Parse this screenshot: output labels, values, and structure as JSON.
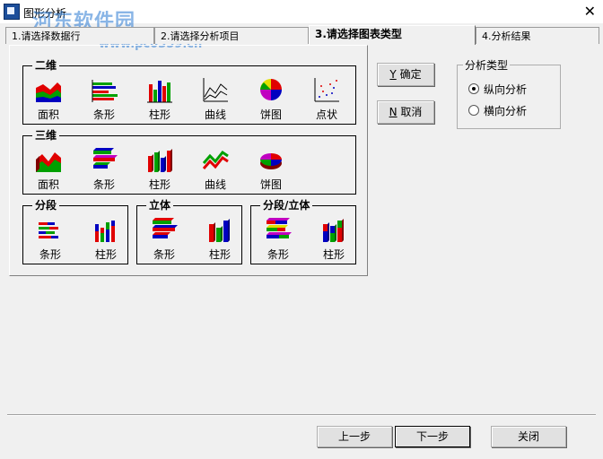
{
  "window": {
    "title": "图形分析",
    "watermark": "河东软件园",
    "watermark_url": "www.pc0359.cn"
  },
  "tabs": [
    {
      "label": "1.请选择数据行"
    },
    {
      "label": "2.请选择分析项目"
    },
    {
      "label": "3.请选择图表类型"
    },
    {
      "label": "4.分析结果"
    }
  ],
  "groups": {
    "two_d": {
      "title": "二维",
      "items": [
        "面积",
        "条形",
        "柱形",
        "曲线",
        "饼图",
        "点状"
      ]
    },
    "three_d": {
      "title": "三维",
      "items": [
        "面积",
        "条形",
        "柱形",
        "曲线",
        "饼图"
      ]
    },
    "segment": {
      "title": "分段",
      "items": [
        "条形",
        "柱形"
      ]
    },
    "solid": {
      "title": "立体",
      "items": [
        "条形",
        "柱形"
      ]
    },
    "segment_solid": {
      "title": "分段/立体",
      "items": [
        "条形",
        "柱形"
      ]
    }
  },
  "buttons": {
    "ok": {
      "key": "Y",
      "label": "确定"
    },
    "cancel": {
      "key": "N",
      "label": "取消"
    },
    "prev": "上一步",
    "next": "下一步",
    "close": "关闭"
  },
  "analysis_type": {
    "title": "分析类型",
    "options": [
      "纵向分析",
      "横向分析"
    ],
    "selected": "纵向分析"
  },
  "colors": {
    "red": "#e00000",
    "green": "#00a000",
    "blue": "#0000c0",
    "yellow": "#e0e000",
    "magenta": "#c000c0"
  }
}
